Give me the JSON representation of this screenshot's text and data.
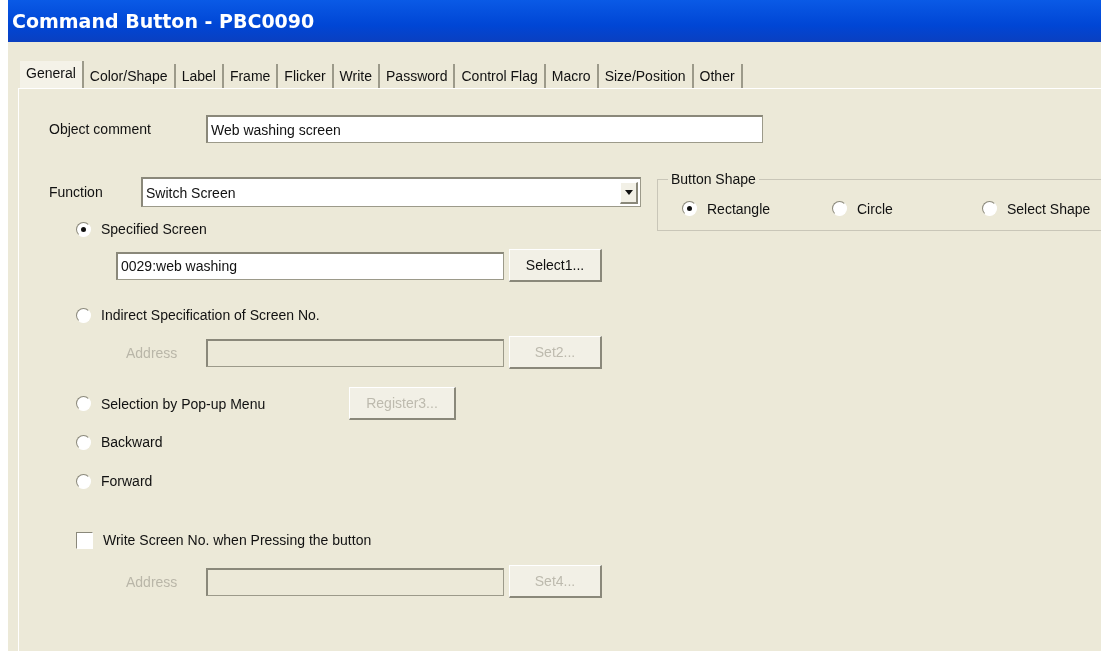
{
  "window": {
    "title": "Command Button - PBC0090"
  },
  "tabs": [
    {
      "label": "General",
      "selected": true
    },
    {
      "label": "Color/Shape",
      "selected": false
    },
    {
      "label": "Label",
      "selected": false
    },
    {
      "label": "Frame",
      "selected": false
    },
    {
      "label": "Flicker",
      "selected": false
    },
    {
      "label": "Write",
      "selected": false
    },
    {
      "label": "Password",
      "selected": false
    },
    {
      "label": "Control Flag",
      "selected": false
    },
    {
      "label": "Macro",
      "selected": false
    },
    {
      "label": "Size/Position",
      "selected": false
    },
    {
      "label": "Other",
      "selected": false
    }
  ],
  "object_comment": {
    "label": "Object comment",
    "value": "Web washing screen"
  },
  "function": {
    "label": "Function",
    "value": "Switch Screen"
  },
  "screen_options": [
    {
      "label": "Specified Screen",
      "selected": true,
      "field": {
        "value": "0029:web washing",
        "disabled": false
      },
      "button": {
        "label": "Select1...",
        "disabled": false
      }
    },
    {
      "label": "Indirect Specification of Screen No.",
      "selected": false,
      "field": {
        "label": "Address",
        "disabled": true
      },
      "button": {
        "label": "Set2...",
        "disabled": true
      }
    },
    {
      "label": "Selection by Pop-up Menu",
      "selected": false,
      "button": {
        "label": "Register3...",
        "disabled": true
      }
    },
    {
      "label": "Backward",
      "selected": false
    },
    {
      "label": "Forward",
      "selected": false
    }
  ],
  "write_screen_no": {
    "label": "Write Screen No. when Pressing the button",
    "checked": false,
    "field": {
      "label": "Address",
      "disabled": true
    },
    "button": {
      "label": "Set4...",
      "disabled": true
    }
  },
  "button_shape": {
    "title": "Button Shape",
    "options": [
      {
        "label": "Rectangle",
        "selected": true
      },
      {
        "label": "Circle",
        "selected": false
      },
      {
        "label": "Select Shape",
        "selected": false
      }
    ]
  }
}
